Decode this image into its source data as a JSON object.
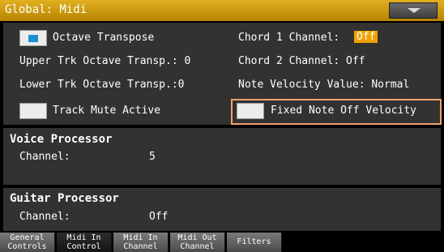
{
  "header": {
    "title": "Global: Midi"
  },
  "main": {
    "octave_transpose": {
      "label": "Octave Transpose",
      "checked": true
    },
    "upper_trk": "Upper Trk Octave Transp.: 0",
    "lower_trk": "Lower Trk Octave Transp.:0",
    "track_mute": {
      "label": "Track Mute Active",
      "checked": false
    },
    "chord1": {
      "label": "Chord 1 Channel:",
      "value": "Off"
    },
    "chord2": "Chord 2 Channel: Off",
    "note_velocity": "Note Velocity Value: Normal",
    "fixed_note_off": {
      "label": "Fixed Note Off Velocity",
      "checked": false
    }
  },
  "voice_processor": {
    "title": "Voice Processor",
    "channel_label": "Channel:",
    "channel_value": "5"
  },
  "guitar_processor": {
    "title": "Guitar Processor",
    "channel_label": "Channel:",
    "channel_value": "Off"
  },
  "tabs": [
    {
      "line1": "General",
      "line2": "Controls"
    },
    {
      "line1": "Midi In",
      "line2": "Control"
    },
    {
      "line1": "Midi In",
      "line2": "Channel"
    },
    {
      "line1": "Midi Out",
      "line2": "Channel"
    },
    {
      "line1": "Filters",
      "line2": ""
    }
  ],
  "colors": {
    "accent": "#f0a000",
    "highlight_border": "#f0a070",
    "checkbox_mark": "#1f8fd0"
  }
}
